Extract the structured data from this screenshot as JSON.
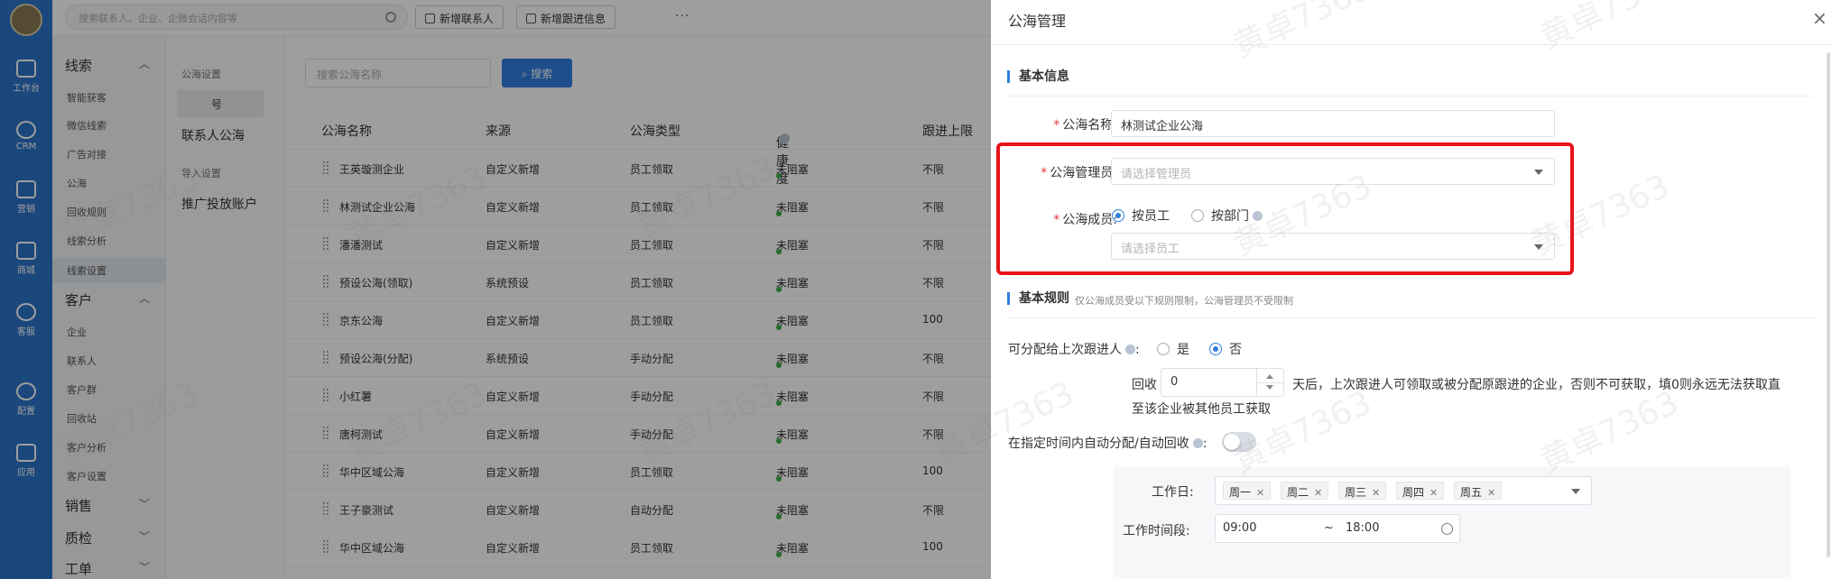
{
  "rail": {
    "items": [
      {
        "label": "工作台",
        "icon": "workbench-icon"
      },
      {
        "label": "CRM",
        "icon": "user-icon"
      },
      {
        "label": "营销",
        "icon": "chart-icon"
      },
      {
        "label": "商城",
        "icon": "store-icon"
      },
      {
        "label": "客服",
        "icon": "chat-icon"
      },
      {
        "label": "配置",
        "icon": "gear-icon"
      },
      {
        "label": "应用",
        "icon": "apps-icon"
      }
    ]
  },
  "menu": {
    "groups": [
      {
        "label": "线索",
        "items": [
          "智能获客",
          "微信线索",
          "广告对接",
          "公海",
          "回收规则",
          "线索分析",
          "线索设置"
        ]
      },
      {
        "label": "客户",
        "items": [
          "企业",
          "联系人",
          "客户群",
          "回收站",
          "客户分析",
          "客户设置"
        ]
      },
      {
        "label": "销售",
        "items": []
      },
      {
        "label": "质检",
        "items": []
      },
      {
        "label": "工单",
        "items": []
      }
    ]
  },
  "sub": {
    "section1": "公海设置",
    "item_tail": "号",
    "contact_pool": "联系人公海",
    "section2": "导入设置",
    "ad_account": "推广投放账户"
  },
  "topbar": {
    "search_placeholder": "搜索联系人、企业、企微会话内容等",
    "btn_add_contact": "新增联系人",
    "btn_add_followup": "新增跟进信息",
    "more": "···"
  },
  "list": {
    "search_placeholder": "搜索公海名称",
    "search_button": "搜索",
    "columns": [
      "公海名称",
      "来源",
      "公海类型",
      "健康度",
      "跟进上限"
    ],
    "rows": [
      [
        "王英璇测企业",
        "自定义新增",
        "员工领取",
        "未阻塞",
        "不限"
      ],
      [
        "林测试企业公海",
        "自定义新增",
        "员工领取",
        "未阻塞",
        "不限"
      ],
      [
        "潘潘测试",
        "自定义新增",
        "员工领取",
        "未阻塞",
        "不限"
      ],
      [
        "预设公海(领取)",
        "系统预设",
        "员工领取",
        "未阻塞",
        "不限"
      ],
      [
        "京东公海",
        "自定义新增",
        "员工领取",
        "未阻塞",
        "100"
      ],
      [
        "预设公海(分配)",
        "系统预设",
        "手动分配",
        "未阻塞",
        "不限"
      ],
      [
        "小红薯",
        "自定义新增",
        "手动分配",
        "未阻塞",
        "不限"
      ],
      [
        "唐柯测试",
        "自定义新增",
        "手动分配",
        "未阻塞",
        "不限"
      ],
      [
        "华中区域公海",
        "自定义新增",
        "员工领取",
        "未阻塞",
        "100"
      ],
      [
        "王子豪测试",
        "自定义新增",
        "自动分配",
        "未阻塞",
        "不限"
      ],
      [
        "华中区域公海",
        "自定义新增",
        "员工领取",
        "未阻塞",
        "100"
      ]
    ]
  },
  "drawer": {
    "title": "公海管理",
    "close": "×",
    "basic_info": "基本信息",
    "name_label": "公海名称:",
    "name_value": "林测试企业公海",
    "admin_label": "公海管理员:",
    "admin_placeholder": "请选择管理员",
    "member_label": "公海成员:",
    "radio_by_employee": "按员工",
    "radio_by_department": "按部门",
    "member_placeholder": "请选择员工",
    "rules_title": "基本规则",
    "rules_note": "仅公海成员受以下规则限制，公海管理员不受限制",
    "assignable_label": "可分配给上次跟进人",
    "assignable_yes": "是",
    "assignable_no": "否",
    "recycle_prefix": "回收",
    "recycle_value": "0",
    "recycle_suffix": "天后，上次跟进人可领取或被分配原跟进的企业，否则不可获取，填0则永远无法获取直",
    "recycle_line2": "至该企业被其他员工获取",
    "auto_label": "在指定时间内自动分配/自动回收",
    "workday_label": "工作日:",
    "workdays": [
      "周一",
      "周二",
      "周三",
      "周四",
      "周五"
    ],
    "worktime_label": "工作时间段:",
    "time_start": "09:00",
    "time_sep": "~",
    "time_end": "18:00",
    "colon": ":"
  },
  "watermark": "黄卓7363",
  "colors": {
    "primary": "#2f7fe0",
    "rail": "#2b73c8",
    "highlight": "#e8121b",
    "health_dot": "#3cb04b"
  }
}
